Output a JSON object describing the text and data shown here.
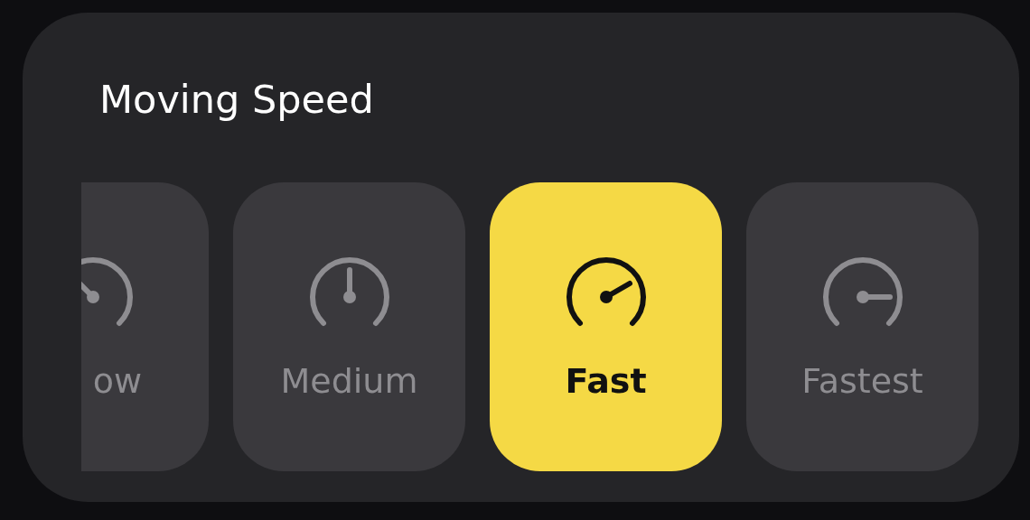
{
  "title": "Moving Speed",
  "options": [
    {
      "label": "ow",
      "kind": "slow",
      "selected": false,
      "cut": true
    },
    {
      "label": "Medium",
      "kind": "medium",
      "selected": false,
      "cut": false
    },
    {
      "label": "Fast",
      "kind": "fast",
      "selected": true,
      "cut": false
    },
    {
      "label": "Fastest",
      "kind": "fastest",
      "selected": false,
      "cut": false
    }
  ]
}
